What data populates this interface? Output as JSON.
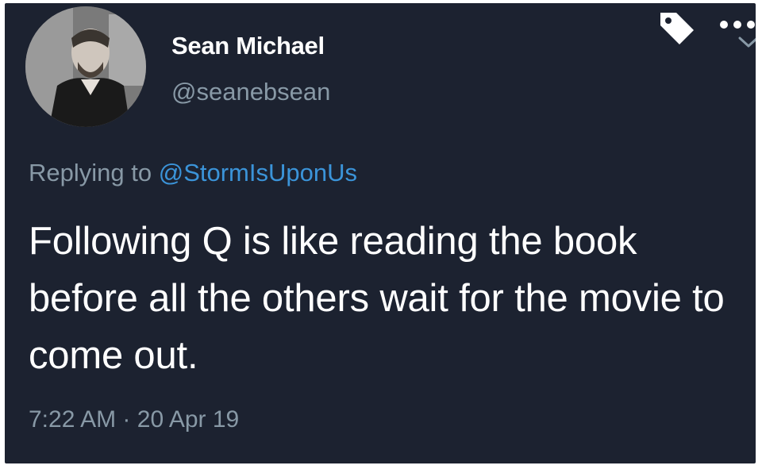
{
  "tweet": {
    "author_name": "Sean Michael",
    "author_handle": "@seanebsean",
    "replying_prefix": "Replying to",
    "replying_to": "@StormIsUponUs",
    "text": "Following Q is like reading the book before all the others wait for the movie to come out.",
    "time": "7:22 AM",
    "separator": "·",
    "date": "20 Apr 19"
  },
  "icons": {
    "tag": "tag-icon",
    "more": "more-dots-icon",
    "chevron": "chevron-down-icon"
  },
  "colors": {
    "background": "#1c2230",
    "primary_text": "#ffffff",
    "secondary_text": "#8899a6",
    "link": "#3b94d9"
  }
}
